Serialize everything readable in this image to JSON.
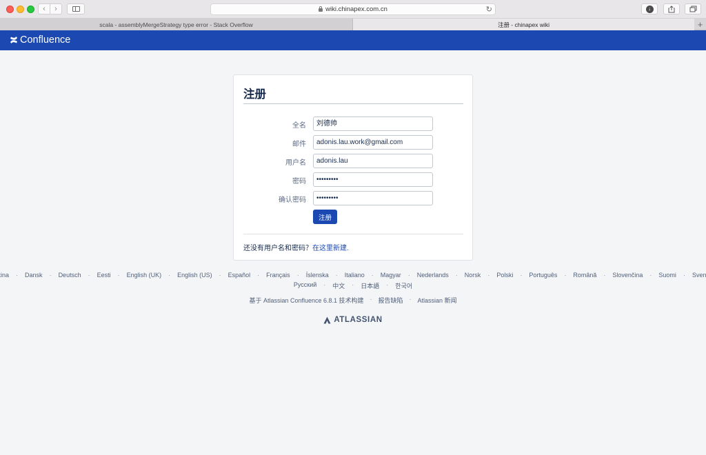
{
  "browser": {
    "url": "wiki.chinapex.com.cn",
    "tabs": [
      {
        "label": "scala - assemblyMergeStrategy type error - Stack Overflow",
        "active": false
      },
      {
        "label": "注册 - chinapex wiki",
        "active": true
      }
    ],
    "new_tab_label": "+"
  },
  "header": {
    "logo_text": "Confluence",
    "brand_color": "#1b49b1"
  },
  "signup": {
    "title": "注册",
    "fields": [
      {
        "label": "全名",
        "value": "刘德帅",
        "type": "text"
      },
      {
        "label": "邮件",
        "value": "adonis.lau.work@gmail.com",
        "type": "text"
      },
      {
        "label": "用户名",
        "value": "adonis.lau",
        "type": "text"
      },
      {
        "label": "密码",
        "value": "•••••••••",
        "type": "password"
      },
      {
        "label": "确认密码",
        "value": "•••••••••",
        "type": "password"
      }
    ],
    "submit_label": "注册",
    "footer_text": "还没有用户名和密码？",
    "footer_link": "在这里新建."
  },
  "footer": {
    "languages_row1": [
      "Čeština",
      "Dansk",
      "Deutsch",
      "Eesti",
      "English (UK)",
      "English (US)",
      "Español",
      "Français",
      "Íslenska",
      "Italiano",
      "Magyar",
      "Nederlands",
      "Norsk",
      "Polski",
      "Português",
      "Română",
      "Slovenčina",
      "Suomi",
      "Svenska"
    ],
    "languages_row2": [
      "Русский",
      "中文",
      "日本語",
      "한국어"
    ],
    "info": [
      "基于 Atlassian Confluence 6.8.1 技术构建",
      "报告缺陷",
      "Atlassian 新闻"
    ],
    "atlassian_logo_text": "ATLASSIAN"
  }
}
